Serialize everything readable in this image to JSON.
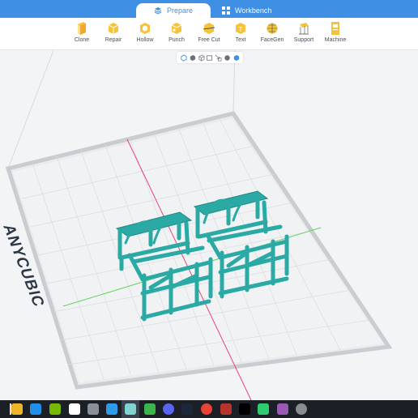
{
  "tabs": {
    "prepare_label": "Prepare",
    "workbench_label": "Workbench"
  },
  "toolbar": {
    "items": [
      {
        "label": "Clone",
        "icon": "clone-icon"
      },
      {
        "label": "Repair",
        "icon": "repair-icon"
      },
      {
        "label": "Hollow",
        "icon": "hollow-icon"
      },
      {
        "label": "Punch",
        "icon": "punch-icon"
      },
      {
        "label": "Free Cut",
        "icon": "free-cut-icon"
      },
      {
        "label": "Text",
        "icon": "text-icon"
      },
      {
        "label": "FaceGen",
        "icon": "facegen-icon"
      },
      {
        "label": "Support",
        "icon": "support-icon"
      },
      {
        "label": "Machine",
        "icon": "machine-icon"
      }
    ]
  },
  "viewport": {
    "brand_text": "ANYCUBIC",
    "model_color": "#2aa9a5"
  },
  "colors": {
    "accent": "#3f8fe4",
    "axis_x": "#e8447a",
    "axis_y": "#5fd35f"
  }
}
